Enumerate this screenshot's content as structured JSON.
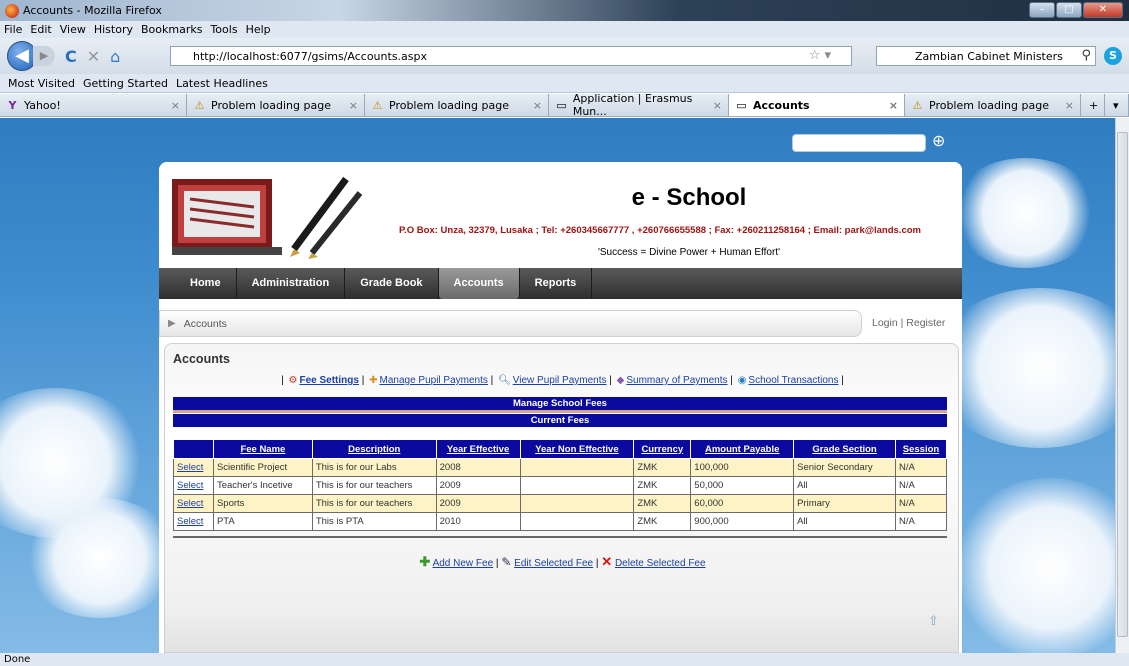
{
  "window": {
    "title": "Accounts - Mozilla Firefox"
  },
  "menu": [
    "File",
    "Edit",
    "View",
    "History",
    "Bookmarks",
    "Tools",
    "Help"
  ],
  "nav": {
    "url": "http://localhost:6077/gsims/Accounts.aspx",
    "search_text": "Zambian Cabinet Ministers"
  },
  "bookmarks": [
    "Most Visited",
    "Getting Started",
    "Latest Headlines"
  ],
  "tabs": [
    {
      "label": "Yahoo!",
      "icon": "yahoo-icon"
    },
    {
      "label": "Problem loading page",
      "icon": "warning-icon"
    },
    {
      "label": "Problem loading page",
      "icon": "warning-icon"
    },
    {
      "label": "Application | Erasmus Mun...",
      "icon": "page-icon"
    },
    {
      "label": "Accounts",
      "icon": "page-icon",
      "active": true
    },
    {
      "label": "Problem loading page",
      "icon": "warning-icon"
    }
  ],
  "site": {
    "title": "e - School",
    "contact": "P.O Box: Unza, 32379, Lusaka ; Tel: +260345667777 , +260766655588 ; Fax: +260211258164 ; Email: park@lands.com",
    "motto": "'Success = Divine Power + Human Effort'"
  },
  "mainnav": [
    "Home",
    "Administration",
    "Grade Book",
    "Accounts",
    "Reports"
  ],
  "breadcrumb": "Accounts",
  "login": "Login",
  "register": "Register",
  "page_heading": "Accounts",
  "toolbar_links": [
    "Fee Settings",
    "Manage Pupil Payments",
    "View Pupil Payments",
    "Summary of Payments",
    "School Transactions"
  ],
  "bands": {
    "manage": "Manage School Fees",
    "current": "Current Fees"
  },
  "table": {
    "headers": [
      "",
      "Fee Name",
      "Description",
      "Year Effective",
      "Year Non Effective",
      "Currency",
      "Amount Payable",
      "Grade Section",
      "Session"
    ],
    "select_label": "Select",
    "rows": [
      [
        "Scientific Project",
        "This is for our Labs",
        "2008",
        "",
        "ZMK",
        "100,000",
        "Senior Secondary",
        "N/A"
      ],
      [
        "Teacher's Incetive",
        "This is for our teachers",
        "2009",
        "",
        "ZMK",
        "50,000",
        "All",
        "N/A"
      ],
      [
        "Sports",
        "This is for our teachers",
        "2009",
        "",
        "ZMK",
        "60,000",
        "Primary",
        "N/A"
      ],
      [
        "PTA",
        "This is PTA",
        "2010",
        "",
        "ZMK",
        "900,000",
        "All",
        "N/A"
      ]
    ]
  },
  "actions": {
    "add": "Add New Fee",
    "edit": "Edit Selected Fee",
    "delete": "Delete Selected Fee"
  },
  "status": "Done"
}
